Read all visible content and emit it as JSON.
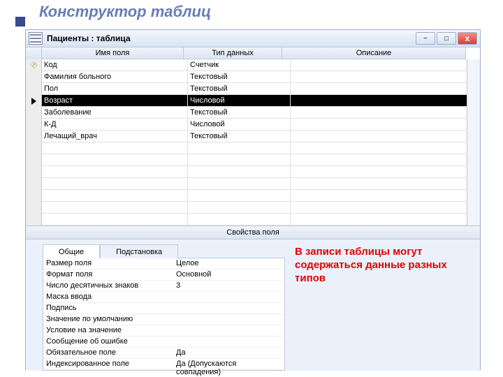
{
  "slide_title": "Конструктор таблиц",
  "window": {
    "title": "Пациенты : таблица",
    "columns": {
      "name": "Имя поля",
      "type": "Тип данных",
      "desc": "Описание"
    },
    "rows": [
      {
        "marker": "key",
        "name": "Код",
        "type": "Счетчик",
        "desc": ""
      },
      {
        "marker": "",
        "name": "Фамилия больного",
        "type": "Текстовый",
        "desc": ""
      },
      {
        "marker": "",
        "name": "Пол",
        "type": "Текстовый",
        "desc": ""
      },
      {
        "marker": "current",
        "name": "Возраст",
        "type": "Числовой",
        "desc": ""
      },
      {
        "marker": "",
        "name": "Заболевание",
        "type": "Текстовый",
        "desc": ""
      },
      {
        "marker": "",
        "name": "К-Д",
        "type": "Числовой",
        "desc": ""
      },
      {
        "marker": "",
        "name": "Лечащий_врач",
        "type": "Текстовый",
        "desc": ""
      }
    ],
    "empty_rows": 7,
    "props_label": "Свойства поля",
    "tabs": {
      "general": "Общие",
      "lookup": "Подстановка"
    },
    "props": [
      {
        "label": "Размер поля",
        "value": "Целое"
      },
      {
        "label": "Формат поля",
        "value": "Основной"
      },
      {
        "label": "Число десятичных знаков",
        "value": "3"
      },
      {
        "label": "Маска ввода",
        "value": ""
      },
      {
        "label": "Подпись",
        "value": ""
      },
      {
        "label": "Значение по умолчанию",
        "value": ""
      },
      {
        "label": "Условие на значение",
        "value": ""
      },
      {
        "label": "Сообщение об ошибке",
        "value": ""
      },
      {
        "label": "Обязательное поле",
        "value": "Да"
      },
      {
        "label": "Индексированное поле",
        "value": "Да (Допускаются совпадения)"
      }
    ]
  },
  "callout": "В записи таблицы могут содержаться данные разных типов"
}
